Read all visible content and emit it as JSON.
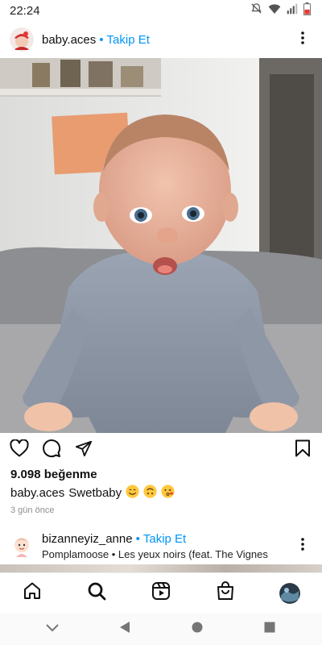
{
  "status_bar": {
    "time": "22:24",
    "icons": [
      "mute-icon",
      "wifi-icon",
      "signal-icon",
      "battery-icon"
    ]
  },
  "post": {
    "username": "baby.aces",
    "separator": "•",
    "follow_label": "Takip Et",
    "likes": "9.098 beğenme",
    "caption_user": "baby.aces",
    "caption_text": "Swetbaby",
    "caption_emojis": [
      "smiling-face-emoji",
      "upside-down-face-emoji",
      "kissing-face-emoji"
    ],
    "time_ago": "3 gün önce"
  },
  "next_post": {
    "username": "bizanneyiz_anne",
    "separator": "•",
    "follow_label": "Takip Et",
    "audio": "Pomplamoose • Les yeux noirs (feat. The Vignes"
  },
  "bottom_nav": [
    "home-icon",
    "search-icon",
    "reels-icon",
    "shop-icon",
    "profile-avatar"
  ],
  "colors": {
    "accent": "#0095f6",
    "muted": "#8e8e8e"
  }
}
